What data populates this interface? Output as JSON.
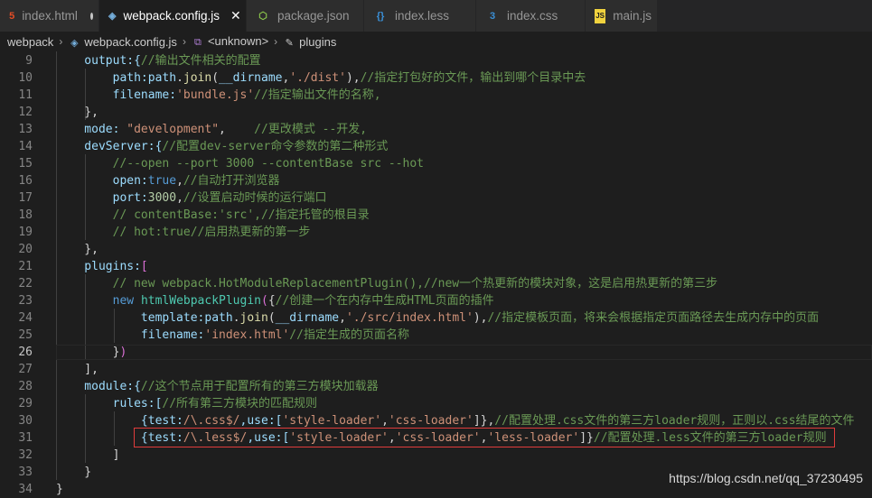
{
  "tabs": [
    {
      "label": "index.html",
      "icon": "html5-icon",
      "icon_color": "#e44d26",
      "modified": true,
      "active": false
    },
    {
      "label": "webpack.config.js",
      "icon": "webpack-cube-icon",
      "icon_color": "#75afdc",
      "modified": false,
      "active": true
    },
    {
      "label": "package.json",
      "icon": "nodejs-icon",
      "icon_color": "#8cc84b",
      "modified": false,
      "active": false
    },
    {
      "label": "index.less",
      "icon": "json-braces-icon",
      "icon_color": "#3a8fd6",
      "modified": false,
      "active": false
    },
    {
      "label": "index.css",
      "icon": "css3-icon",
      "icon_color": "#3a8fd6",
      "modified": false,
      "active": false
    },
    {
      "label": "main.js",
      "icon": "js-icon",
      "icon_color": "#f0d23e",
      "modified": false,
      "active": false
    }
  ],
  "breadcrumb": [
    "webpack",
    "webpack.config.js",
    "<unknown>",
    "plugins"
  ],
  "colors": {
    "background": "#1e1e1e",
    "line_number": "#858585",
    "highlight_border": "#e03c3c"
  },
  "code_lines": [
    {
      "n": "9",
      "tokens": [
        [
          "    output:{",
          "var"
        ],
        [
          "//输出文件相关的配置",
          "com"
        ]
      ]
    },
    {
      "n": "10",
      "tokens": [
        [
          "        path:",
          "var"
        ],
        [
          "path",
          "var"
        ],
        [
          ".",
          "p"
        ],
        [
          "join",
          "fn"
        ],
        [
          "(",
          "p"
        ],
        [
          "__dirname",
          "var"
        ],
        [
          ",",
          "p"
        ],
        [
          "'./dist'",
          "str"
        ],
        [
          "),",
          "p"
        ],
        [
          "//指定打包好的文件，输出到哪个目录中去",
          "com"
        ]
      ]
    },
    {
      "n": "11",
      "tokens": [
        [
          "        filename:",
          "var"
        ],
        [
          "'bundle.js'",
          "str"
        ],
        [
          "//指定输出文件的名称,",
          "com"
        ]
      ]
    },
    {
      "n": "12",
      "tokens": [
        [
          "    },",
          "p"
        ]
      ]
    },
    {
      "n": "13",
      "tokens": [
        [
          "    mode: ",
          "var"
        ],
        [
          "\"development\"",
          "str"
        ],
        [
          ",    ",
          "p"
        ],
        [
          "//更改模式 --开发,",
          "com"
        ]
      ]
    },
    {
      "n": "14",
      "tokens": [
        [
          "    devServer:{",
          "var"
        ],
        [
          "//配置dev-server命令参数的第二种形式",
          "com"
        ]
      ]
    },
    {
      "n": "15",
      "tokens": [
        [
          "        //--open --port 3000 --contentBase src --hot",
          "com"
        ]
      ]
    },
    {
      "n": "16",
      "tokens": [
        [
          "        open:",
          "var"
        ],
        [
          "true",
          "kw"
        ],
        [
          ",",
          "p"
        ],
        [
          "//自动打开浏览器",
          "com"
        ]
      ]
    },
    {
      "n": "17",
      "tokens": [
        [
          "        port:",
          "var"
        ],
        [
          "3000",
          "num"
        ],
        [
          ",",
          "p"
        ],
        [
          "//设置启动时候的运行端口",
          "com"
        ]
      ]
    },
    {
      "n": "18",
      "tokens": [
        [
          "        // contentBase:'src',//指定托管的根目录",
          "com"
        ]
      ]
    },
    {
      "n": "19",
      "tokens": [
        [
          "        // hot:true//启用热更新的第一步",
          "com"
        ]
      ]
    },
    {
      "n": "20",
      "tokens": [
        [
          "    },",
          "p"
        ]
      ]
    },
    {
      "n": "21",
      "tokens": [
        [
          "    plugins:",
          "var"
        ],
        [
          "[",
          "br"
        ]
      ]
    },
    {
      "n": "22",
      "tokens": [
        [
          "        // new webpack.HotModuleReplacementPlugin(),//new一个热更新的模块对象，这是启用热更新的第三步",
          "com"
        ]
      ]
    },
    {
      "n": "23",
      "tokens": [
        [
          "        ",
          "p"
        ],
        [
          "new ",
          "kw"
        ],
        [
          "htmlWebpackPlugin",
          "cls"
        ],
        [
          "(",
          "br"
        ],
        [
          "{",
          "p"
        ],
        [
          "//创建一个在内存中生成HTML页面的插件",
          "com"
        ]
      ]
    },
    {
      "n": "24",
      "tokens": [
        [
          "            template:",
          "var"
        ],
        [
          "path",
          "var"
        ],
        [
          ".",
          "p"
        ],
        [
          "join",
          "fn"
        ],
        [
          "(",
          "p"
        ],
        [
          "__dirname",
          "var"
        ],
        [
          ",",
          "p"
        ],
        [
          "'./src/index.html'",
          "str"
        ],
        [
          "),",
          "p"
        ],
        [
          "//指定模板页面，将来会根据指定页面路径去生成内存中的页面",
          "com"
        ]
      ]
    },
    {
      "n": "25",
      "tokens": [
        [
          "            filename:",
          "var"
        ],
        [
          "'index.html'",
          "str"
        ],
        [
          "//指定生成的页面名称",
          "com"
        ]
      ]
    },
    {
      "n": "26",
      "tokens": [
        [
          "        ",
          "p"
        ],
        [
          "}",
          "p"
        ],
        [
          ")",
          "br"
        ]
      ]
    },
    {
      "n": "27",
      "tokens": [
        [
          "    ],",
          "p"
        ]
      ]
    },
    {
      "n": "28",
      "tokens": [
        [
          "    module:{",
          "var"
        ],
        [
          "//这个节点用于配置所有的第三方模块加载器",
          "com"
        ]
      ]
    },
    {
      "n": "29",
      "tokens": [
        [
          "        rules:[",
          "var"
        ],
        [
          "//所有第三方模块的匹配规则",
          "com"
        ]
      ]
    },
    {
      "n": "30",
      "tokens": [
        [
          "            {test:",
          "var"
        ],
        [
          "/\\.css$/",
          "str"
        ],
        [
          ",use:[",
          "var"
        ],
        [
          "'style-loader'",
          "str"
        ],
        [
          ",",
          "p"
        ],
        [
          "'css-loader'",
          "str"
        ],
        [
          "]},",
          "p"
        ],
        [
          "//配置处理.css文件的第三方loader规则，正则以.css结尾的文件",
          "com"
        ]
      ]
    },
    {
      "n": "31",
      "tokens": [
        [
          "            {test:",
          "var"
        ],
        [
          "/\\.less$/",
          "str"
        ],
        [
          ",use:[",
          "var"
        ],
        [
          "'style-loader'",
          "str"
        ],
        [
          ",",
          "p"
        ],
        [
          "'css-loader'",
          "str"
        ],
        [
          ",",
          "p"
        ],
        [
          "'less-loader'",
          "str"
        ],
        [
          "]}",
          "p"
        ],
        [
          "//配置处理.less文件的第三方loader规则",
          "com"
        ]
      ]
    },
    {
      "n": "32",
      "tokens": [
        [
          "        ]",
          "p"
        ]
      ]
    },
    {
      "n": "33",
      "tokens": [
        [
          "    }",
          "p"
        ]
      ]
    },
    {
      "n": "34",
      "tokens": [
        [
          "}",
          "p"
        ]
      ]
    }
  ],
  "current_line": "26",
  "highlighted_line": "31",
  "watermark": "https://blog.csdn.net/qq_37230495"
}
